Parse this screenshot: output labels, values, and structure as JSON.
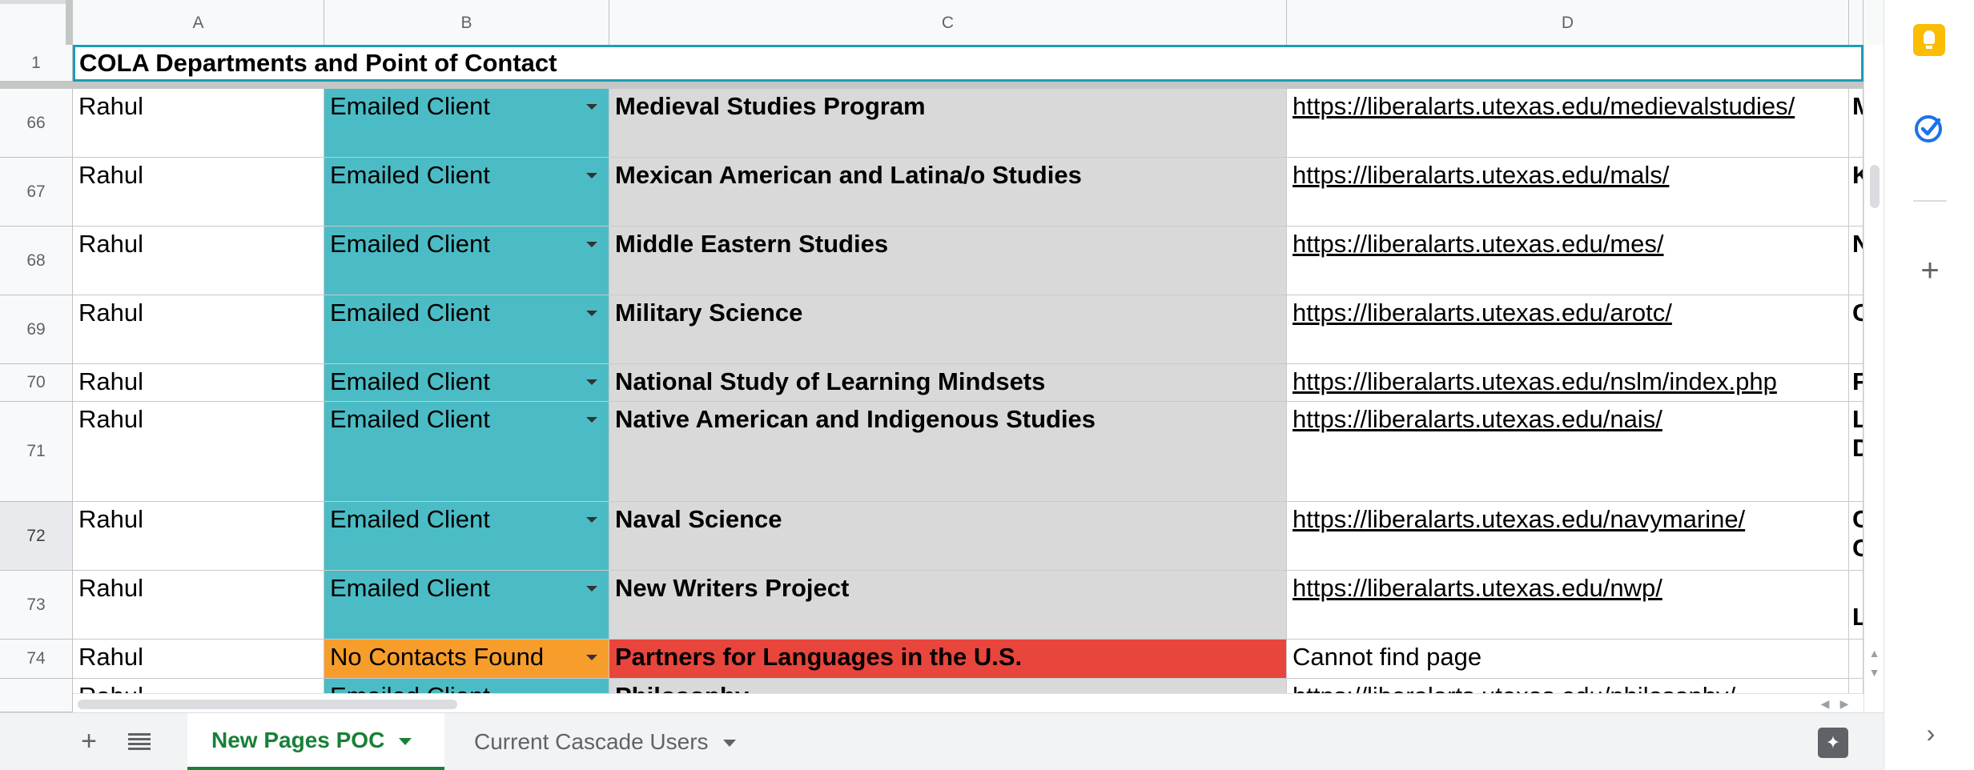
{
  "columns": [
    "A",
    "B",
    "C",
    "D"
  ],
  "title_row": {
    "number": "1",
    "text": "COLA Departments and Point of Contact"
  },
  "rows": [
    {
      "num": "66",
      "owner": "Rahul",
      "status": "Emailed Client",
      "department": "Medieval Studies Program",
      "url": "https://liberalarts.utexas.edu/medievalstudies/",
      "next": "M"
    },
    {
      "num": "67",
      "owner": "Rahul",
      "status": "Emailed Client",
      "department": "Mexican American and Latina/o Studies",
      "url": "https://liberalarts.utexas.edu/mals/",
      "next": "K"
    },
    {
      "num": "68",
      "owner": "Rahul",
      "status": "Emailed Client",
      "department": "Middle Eastern Studies",
      "url": "https://liberalarts.utexas.edu/mes/",
      "next": "N"
    },
    {
      "num": "69",
      "owner": "Rahul",
      "status": "Emailed Client",
      "department": "Military Science",
      "url": "https://liberalarts.utexas.edu/arotc/",
      "next": "C"
    },
    {
      "num": "70",
      "owner": "Rahul",
      "status": "Emailed Client",
      "department": "National Study of Learning Mindsets",
      "url": "https://liberalarts.utexas.edu/nslm/index.php",
      "next": "F"
    },
    {
      "num": "71",
      "owner": "Rahul",
      "status": "Emailed Client",
      "department": "Native American and Indigenous Studies",
      "url": "https://liberalarts.utexas.edu/nais/",
      "next": "L",
      "next2": "D"
    },
    {
      "num": "72",
      "owner": "Rahul",
      "status": "Emailed Client",
      "department": "Naval Science",
      "url": "https://liberalarts.utexas.edu/navymarine/",
      "next": "C",
      "next2": "C"
    },
    {
      "num": "73",
      "owner": "Rahul",
      "status": "Emailed Client",
      "department": "New Writers Project",
      "url": "https://liberalarts.utexas.edu/nwp/",
      "next": "",
      "next2": "L"
    },
    {
      "num": "74",
      "owner": "Rahul",
      "status": "No Contacts Found",
      "department": "Partners for Languages in the U.S.",
      "url": "Cannot find page",
      "next": ""
    },
    {
      "num": "",
      "owner": "Rahul",
      "status": "Emailed Client",
      "department": "Philosophy",
      "url": "https://liberalarts.utexas.edu/philosophy/",
      "next": ""
    }
  ],
  "sheet_tabs": [
    "New Pages POC",
    "Current Cascade Users"
  ],
  "icons": {
    "add_sheet": "plus-icon",
    "all_sheets": "list-icon",
    "explore": "explore-icon",
    "keep": "keep-icon",
    "tasks": "tasks-icon",
    "get_addons": "plus-icon",
    "collapse_panel": "chevron-right-icon"
  },
  "colors": {
    "status_emailed": "#4bbcc5",
    "status_no_contacts": "#f79d2c",
    "department_fill": "#d9d9d9",
    "department_alert": "#e8453c",
    "selection_border": "#1a9fb5",
    "active_tab": "#188038"
  }
}
